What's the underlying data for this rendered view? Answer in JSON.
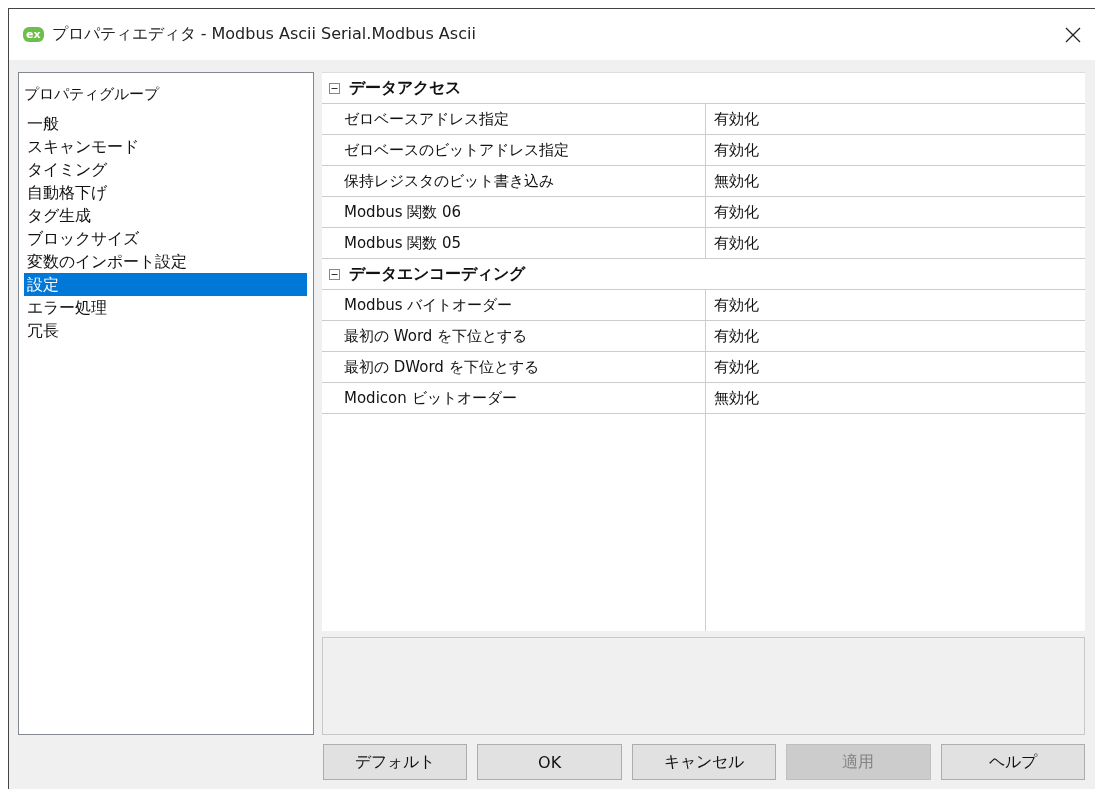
{
  "window": {
    "title": "プロパティエディタ - Modbus Ascii Serial.Modbus Ascii",
    "app_icon": "ex"
  },
  "sidebar": {
    "heading": "プロパティグループ",
    "items": [
      {
        "label": "一般",
        "selected": false
      },
      {
        "label": "スキャンモード",
        "selected": false
      },
      {
        "label": "タイミング",
        "selected": false
      },
      {
        "label": "自動格下げ",
        "selected": false
      },
      {
        "label": "タグ生成",
        "selected": false
      },
      {
        "label": "ブロックサイズ",
        "selected": false
      },
      {
        "label": "変数のインポート設定",
        "selected": false
      },
      {
        "label": "設定",
        "selected": true
      },
      {
        "label": "エラー処理",
        "selected": false
      },
      {
        "label": "冗長",
        "selected": false
      }
    ]
  },
  "property_grid": {
    "categories": [
      {
        "title": "データアクセス",
        "expanded": true,
        "rows": [
          {
            "name": "ゼロベースアドレス指定",
            "value": "有効化"
          },
          {
            "name": "ゼロベースのビットアドレス指定",
            "value": "有効化"
          },
          {
            "name": "保持レジスタのビット書き込み",
            "value": "無効化"
          },
          {
            "name": "Modbus 関数 06",
            "value": "有効化"
          },
          {
            "name": "Modbus 関数 05",
            "value": "有効化"
          }
        ]
      },
      {
        "title": "データエンコーディング",
        "expanded": true,
        "rows": [
          {
            "name": "Modbus バイトオーダー",
            "value": "有効化"
          },
          {
            "name": "最初の Word を下位とする",
            "value": "有効化"
          },
          {
            "name": "最初の DWord を下位とする",
            "value": "有効化"
          },
          {
            "name": "Modicon ビットオーダー",
            "value": "無効化"
          }
        ]
      }
    ]
  },
  "buttons": [
    {
      "label": "デフォルト",
      "disabled": false
    },
    {
      "label": "OK",
      "disabled": false
    },
    {
      "label": "キャンセル",
      "disabled": false
    },
    {
      "label": "適用",
      "disabled": true
    },
    {
      "label": "ヘルプ",
      "disabled": false
    }
  ]
}
